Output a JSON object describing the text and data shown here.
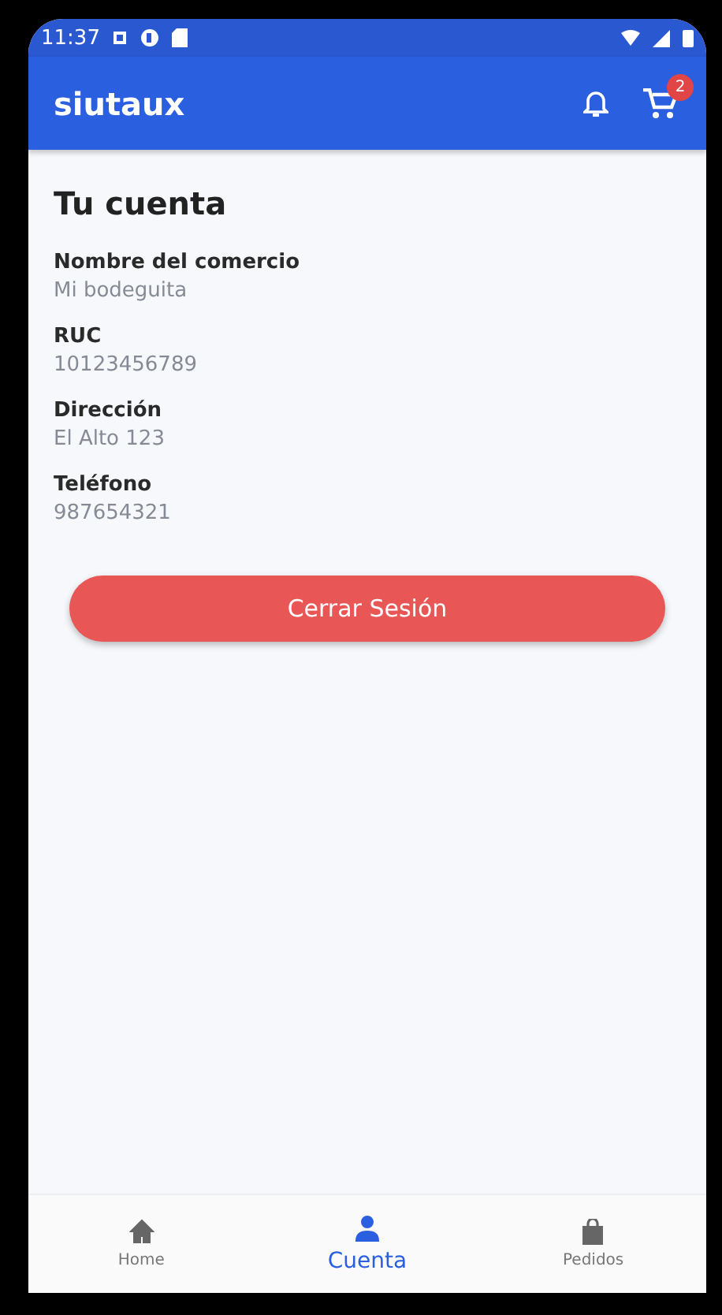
{
  "status_bar": {
    "time": "11:37"
  },
  "app_bar": {
    "title": "siutaux",
    "cart_badge": "2"
  },
  "account": {
    "heading": "Tu cuenta",
    "fields": [
      {
        "label": "Nombre del comercio",
        "value": "Mi bodeguita"
      },
      {
        "label": "RUC",
        "value": "10123456789"
      },
      {
        "label": "Dirección",
        "value": "El Alto 123"
      },
      {
        "label": "Teléfono",
        "value": "987654321"
      }
    ],
    "logout_button": "Cerrar Sesión"
  },
  "bottom_nav": [
    {
      "kind": "home",
      "label": "Home",
      "selected": false
    },
    {
      "kind": "account",
      "label": "Cuenta",
      "selected": true
    },
    {
      "kind": "orders",
      "label": "Pedidos",
      "selected": false
    }
  ]
}
